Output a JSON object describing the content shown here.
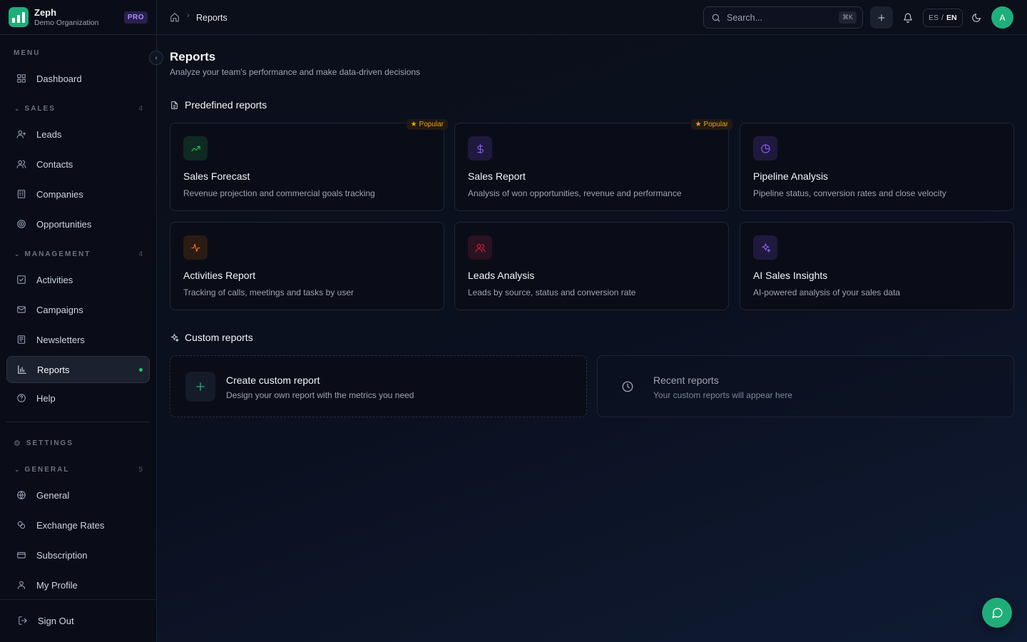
{
  "brand": {
    "name": "Zeph",
    "org": "Demo Organization",
    "badge": "PRO"
  },
  "sidebar": {
    "menu_label": "MENU",
    "dashboard": "Dashboard",
    "sales_group": {
      "label": "SALES",
      "count": "4"
    },
    "sales_items": [
      "Leads",
      "Contacts",
      "Companies",
      "Opportunities"
    ],
    "management_group": {
      "label": "MANAGEMENT",
      "count": "4"
    },
    "management_items": [
      "Activities",
      "Campaigns",
      "Newsletters",
      "Reports"
    ],
    "help": "Help",
    "settings_label": "SETTINGS",
    "general_group": {
      "label": "GENERAL",
      "count": "5"
    },
    "general_items": [
      "General",
      "Exchange Rates",
      "Subscription",
      "My Profile"
    ],
    "sign_out": "Sign Out",
    "active_item": "Reports"
  },
  "topbar": {
    "breadcrumb_current": "Reports",
    "search_placeholder": "Search...",
    "search_shortcut": "⌘K",
    "lang_es": "ES",
    "lang_sep": "/",
    "lang_en": "EN",
    "avatar_initial": "A"
  },
  "page": {
    "title": "Reports",
    "subtitle": "Analyze your team's performance and make data-driven decisions",
    "predefined_title": "Predefined reports",
    "custom_title": "Custom reports",
    "popular_label": "Popular"
  },
  "reports": [
    {
      "title": "Sales Forecast",
      "desc": "Revenue projection and commercial goals tracking",
      "icon": "trending-up-icon",
      "color": "#22c55e",
      "bg": "#0f2a22",
      "popular": true
    },
    {
      "title": "Sales Report",
      "desc": "Analysis of won opportunities, revenue and performance",
      "icon": "dollar-icon",
      "color": "#8b5cf6",
      "bg": "#1f1a3d",
      "popular": true
    },
    {
      "title": "Pipeline Analysis",
      "desc": "Pipeline status, conversion rates and close velocity",
      "icon": "pie-chart-icon",
      "color": "#8b5cf6",
      "bg": "#1f1a3d",
      "popular": false
    },
    {
      "title": "Activities Report",
      "desc": "Tracking of calls, meetings and tasks by user",
      "icon": "activity-icon",
      "color": "#f97316",
      "bg": "#2a1c12",
      "popular": false
    },
    {
      "title": "Leads Analysis",
      "desc": "Leads by source, status and conversion rate",
      "icon": "users-icon",
      "color": "#e11d48",
      "bg": "#2a1220",
      "popular": false
    },
    {
      "title": "AI Sales Insights",
      "desc": "AI-powered analysis of your sales data",
      "icon": "sparkles-icon",
      "color": "#8b5cf6",
      "bg": "#1f1a3d",
      "popular": false
    }
  ],
  "custom": {
    "create_title": "Create custom report",
    "create_desc": "Design your own report with the metrics you need",
    "recent_title": "Recent reports",
    "recent_desc": "Your custom reports will appear here"
  }
}
